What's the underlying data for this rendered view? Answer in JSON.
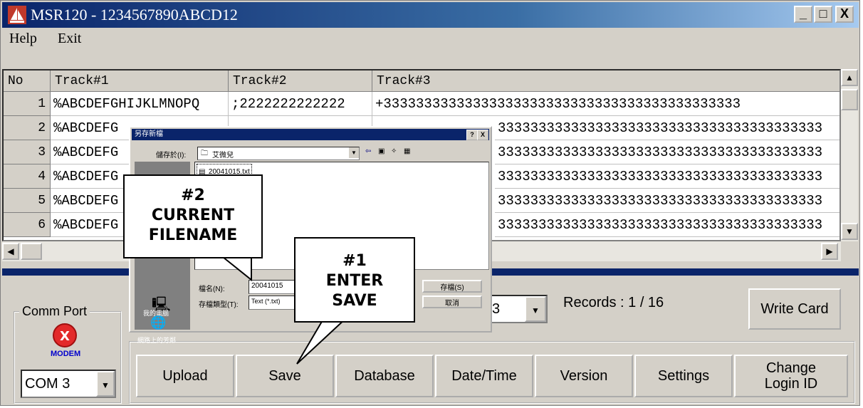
{
  "window": {
    "title": "MSR120 - 1234567890ABCD12",
    "btn_min": "_",
    "btn_max": "□",
    "btn_close": "X"
  },
  "menu": {
    "help": "Help",
    "exit": "Exit"
  },
  "grid": {
    "columns": [
      "No",
      "Track#1",
      "Track#2",
      "Track#3"
    ],
    "rows": [
      {
        "no": "1",
        "t1": "%ABCDEFGHIJKLMNOPQ",
        "t2": ";2222222222222",
        "t3": "+33333333333333333333333333333333333333333333"
      },
      {
        "no": "2",
        "t1": "%ABCDEFG",
        "t2": "",
        "t3": "3333333333333333333333333333333333333333"
      },
      {
        "no": "3",
        "t1": "%ABCDEFG",
        "t2": "",
        "t3": "3333333333333333333333333333333333333333"
      },
      {
        "no": "4",
        "t1": "%ABCDEFG",
        "t2": "",
        "t3": "3333333333333333333333333333333333333333"
      },
      {
        "no": "5",
        "t1": "%ABCDEFG",
        "t2": "",
        "t3": "3333333333333333333333333333333333333333"
      },
      {
        "no": "6",
        "t1": "%ABCDEFG",
        "t2": "",
        "t3": "3333333333333333333333333333333333333333"
      }
    ]
  },
  "comm": {
    "label": "Comm Port",
    "modem_label": "MODEM",
    "port_value": "COM 3"
  },
  "status": {
    "track_select_value": "3",
    "records_text": "Records : 1 / 16",
    "write_card": "Write Card"
  },
  "actions": [
    "Upload",
    "Save",
    "Database",
    "Date/Time",
    "Version",
    "Settings",
    "Change Login ID"
  ],
  "dialog": {
    "title": "另存新檔",
    "help_btn": "?",
    "close_btn": "X",
    "save_in_label": "儲存於(I):",
    "save_in_value": "艾微兒",
    "file_item": "20041015.txt",
    "filename_label": "檔名(N):",
    "filename_value": "20041015",
    "filetype_label": "存檔類型(T):",
    "filetype_value": "Text (*.txt)",
    "save_button": "存檔(S)",
    "cancel_button": "取消",
    "place_mycomputer": "我的電腦",
    "place_network": "網路上的芳鄰"
  },
  "callouts": {
    "c2": [
      "#2",
      "CURRENT",
      "FILENAME"
    ],
    "c1": [
      "#1",
      "ENTER",
      "SAVE"
    ]
  }
}
